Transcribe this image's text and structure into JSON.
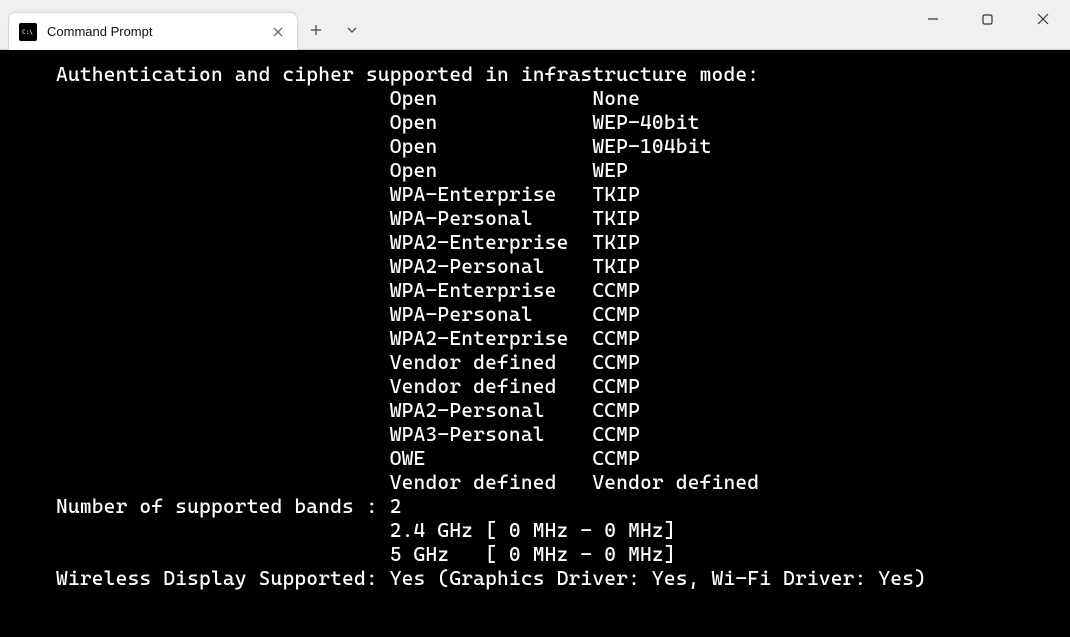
{
  "titlebar": {
    "tab": {
      "icon_label": "C:\\",
      "title": "Command Prompt"
    }
  },
  "terminal": {
    "header": "Authentication and cipher supported in infrastructure mode:",
    "auth_cipher": [
      {
        "auth": "Open",
        "cipher": "None"
      },
      {
        "auth": "Open",
        "cipher": "WEP-40bit"
      },
      {
        "auth": "Open",
        "cipher": "WEP-104bit"
      },
      {
        "auth": "Open",
        "cipher": "WEP"
      },
      {
        "auth": "WPA-Enterprise",
        "cipher": "TKIP"
      },
      {
        "auth": "WPA-Personal",
        "cipher": "TKIP"
      },
      {
        "auth": "WPA2-Enterprise",
        "cipher": "TKIP"
      },
      {
        "auth": "WPA2-Personal",
        "cipher": "TKIP"
      },
      {
        "auth": "WPA-Enterprise",
        "cipher": "CCMP"
      },
      {
        "auth": "WPA-Personal",
        "cipher": "CCMP"
      },
      {
        "auth": "WPA2-Enterprise",
        "cipher": "CCMP"
      },
      {
        "auth": "Vendor defined",
        "cipher": "CCMP"
      },
      {
        "auth": "Vendor defined",
        "cipher": "CCMP"
      },
      {
        "auth": "WPA2-Personal",
        "cipher": "CCMP"
      },
      {
        "auth": "WPA3-Personal",
        "cipher": "CCMP"
      },
      {
        "auth": "OWE",
        "cipher": "CCMP"
      },
      {
        "auth": "Vendor defined",
        "cipher": "Vendor defined"
      }
    ],
    "bands_label": "Number of supported bands :",
    "bands_count": "2",
    "bands": [
      {
        "name": "2.4 GHz",
        "range": "[ 0 MHz - 0 MHz]"
      },
      {
        "name": "5 GHz",
        "range": "[ 0 MHz - 0 MHz]"
      }
    ],
    "wireless_display": "Wireless Display Supported: Yes (Graphics Driver: Yes, Wi-Fi Driver: Yes)"
  }
}
